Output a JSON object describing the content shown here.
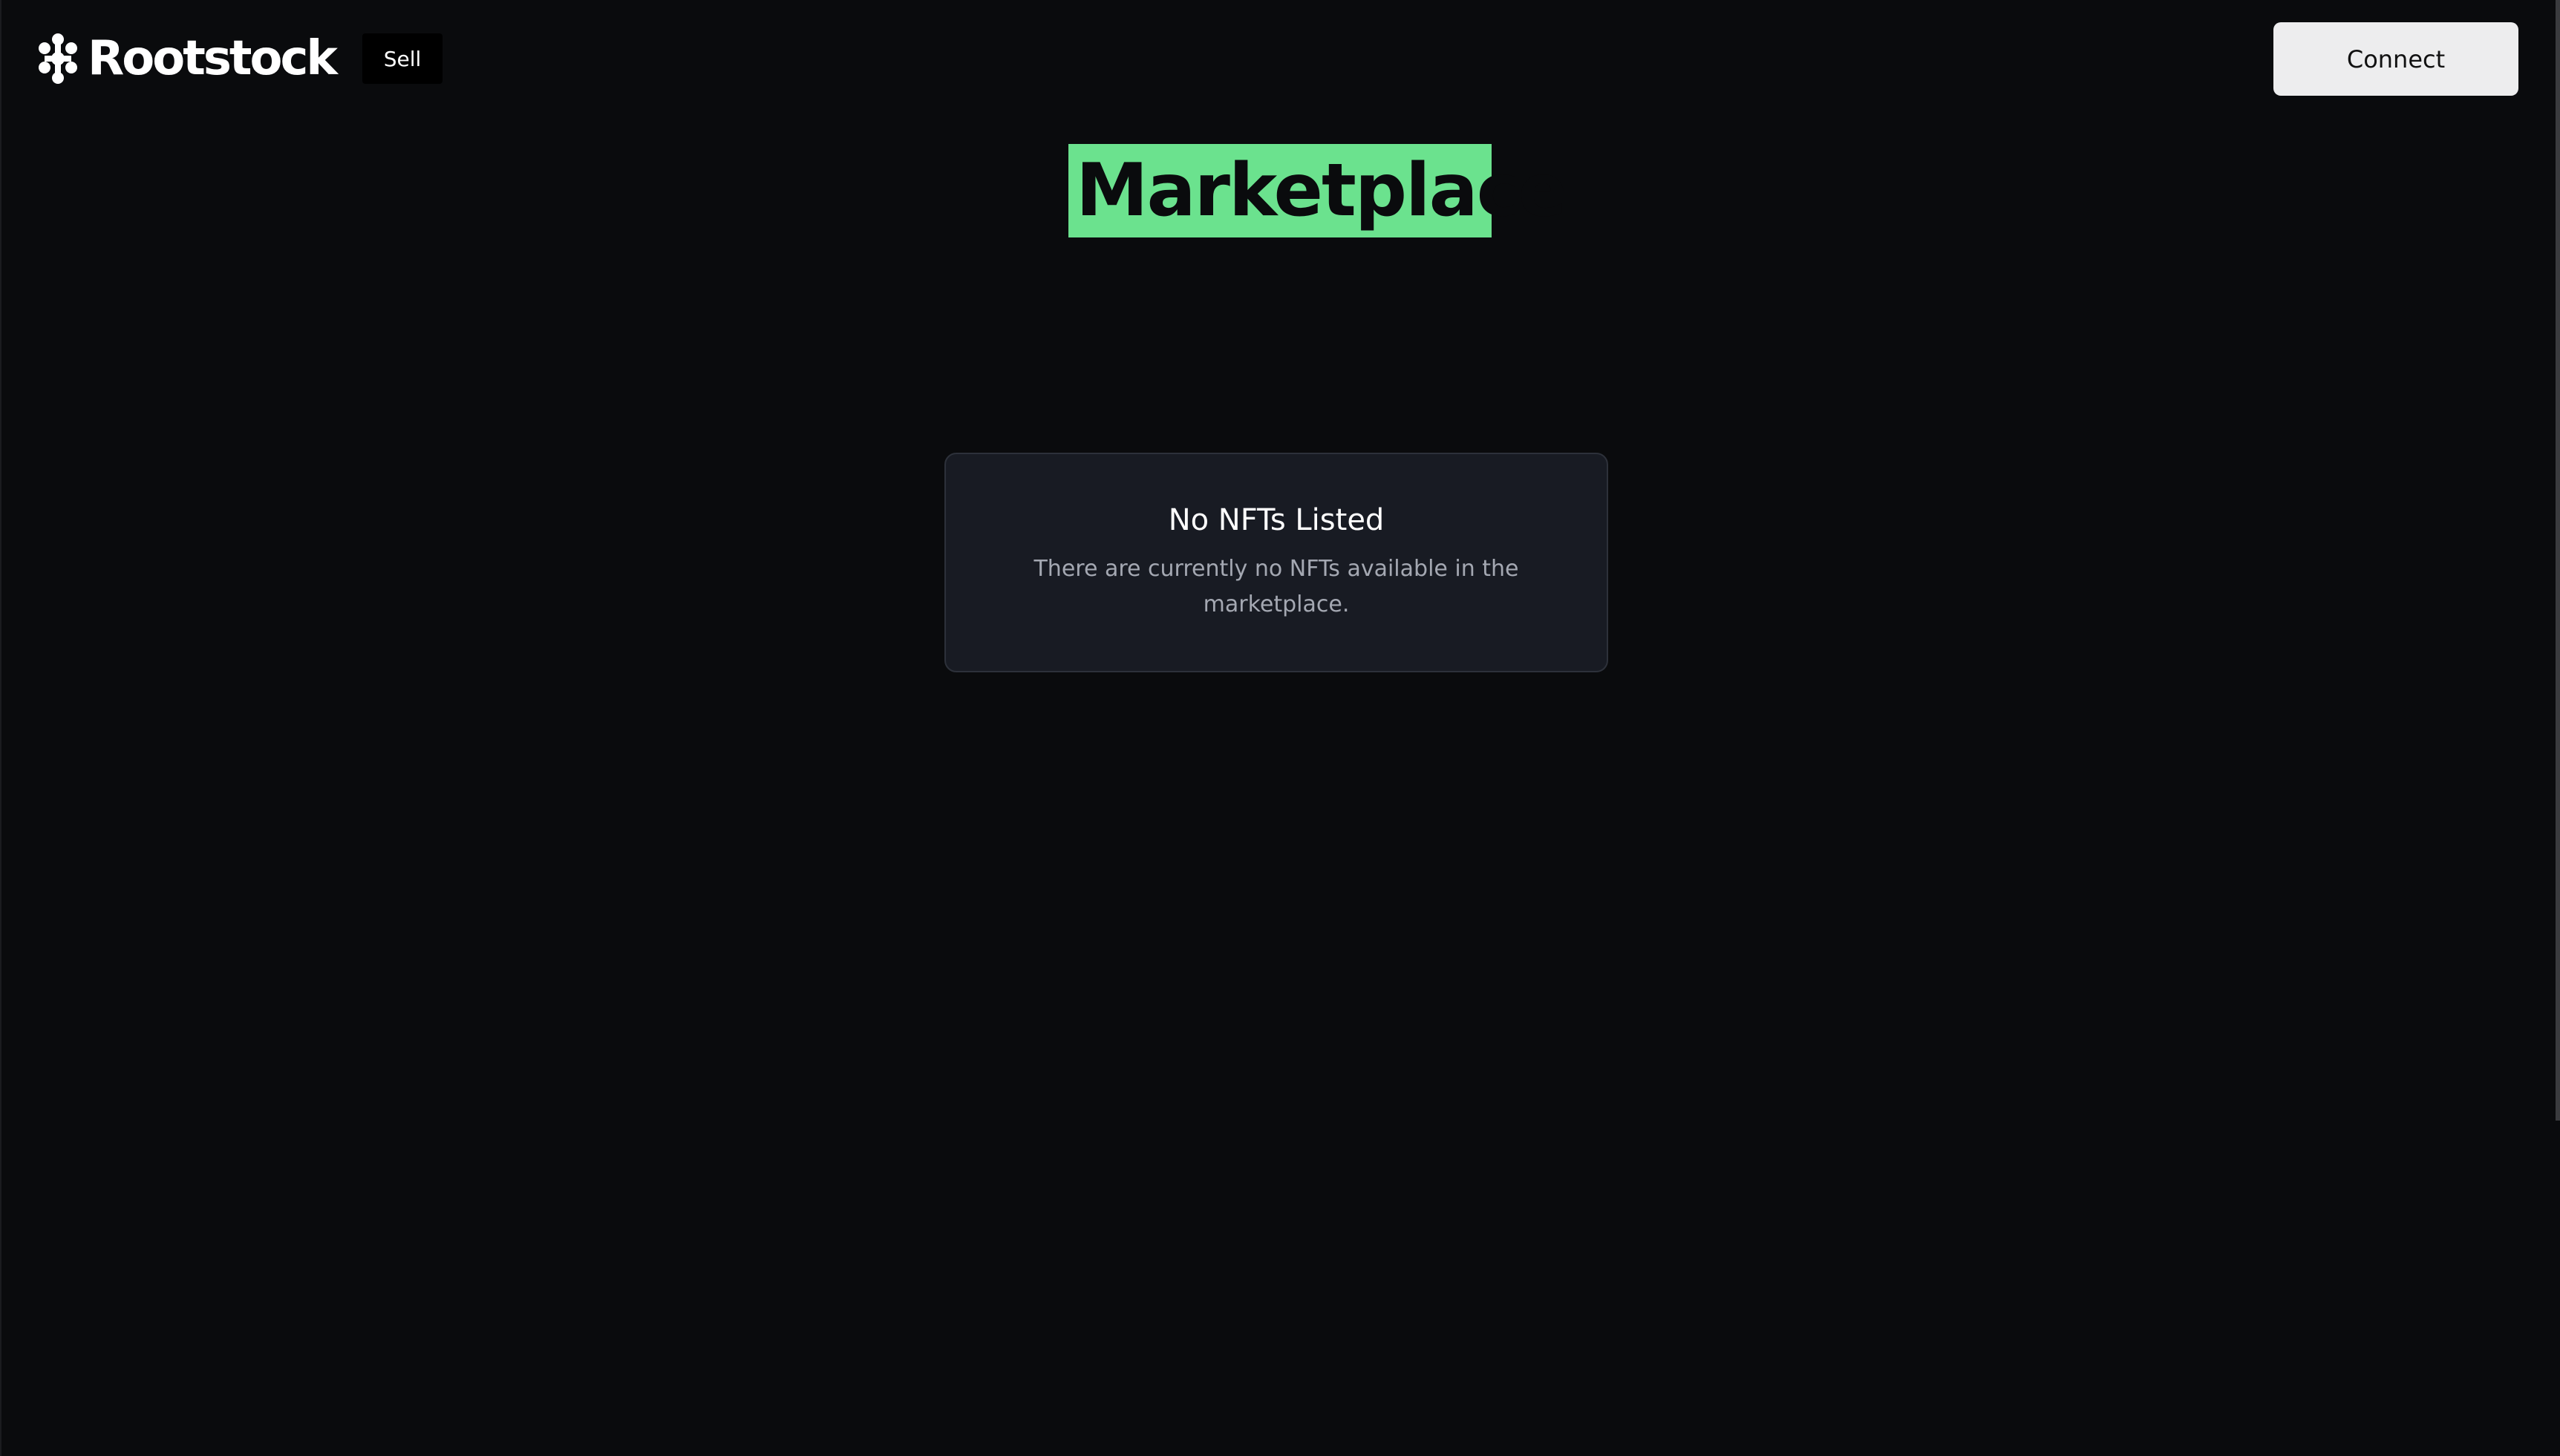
{
  "header": {
    "logo_text": "Rootstock",
    "logo_icon": "rootstock-logo-icon",
    "nav": {
      "sell_label": "Sell"
    },
    "connect_label": "Connect"
  },
  "main": {
    "title": "Marketplace",
    "empty_state": {
      "title": "No NFTs Listed",
      "description": "There are currently no NFTs available in the marketplace."
    }
  },
  "colors": {
    "background": "#0a0b0d",
    "accent": "#6be28e",
    "card_background": "#181b23",
    "card_border": "#2d313a",
    "connect_button": "#ededee"
  }
}
